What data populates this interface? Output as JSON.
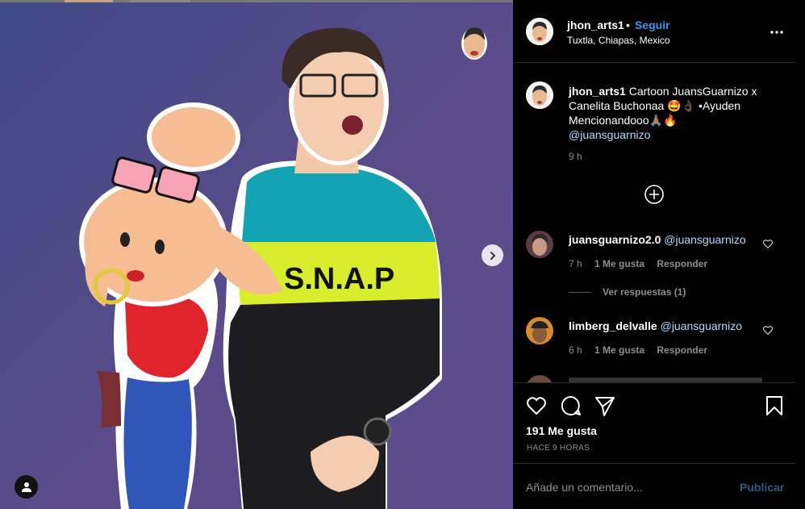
{
  "post": {
    "username": "jhon_arts1",
    "follow_label": "Seguir",
    "separator": "•",
    "location": "Tuxtla, Chiapas, Mexico",
    "caption_text": "Cartoon JuansGuarnizo x Canelita Buchonaa 🤩👌🏿 •Ayuden Mencionandooo🙏🏽🔥",
    "caption_mention": "@juansguarnizo",
    "caption_time": "9 h",
    "likes": "191 Me gusta",
    "time_ago": "HACE 9 HORAS"
  },
  "image": {
    "shirt_text": "S.N.A.P",
    "bg_colors": [
      "#3f4a86",
      "#5f4c8f"
    ]
  },
  "comments": [
    {
      "username": "juansguarnizo2.0",
      "mention": "@juansguarnizo",
      "time": "7 h",
      "likes": "1 Me gusta",
      "reply": "Responder",
      "view_replies": "Ver respuestas (1)"
    },
    {
      "username": "limberg_delvalle",
      "mention": "@juansguarnizo",
      "time": "6 h",
      "likes": "1 Me gusta",
      "reply": "Responder"
    }
  ],
  "add_comment": {
    "placeholder": "Añade un comentario...",
    "publish_label": "Publicar"
  },
  "colors": {
    "accent": "#3897f0",
    "mention": "#b3dbff",
    "muted": "#8e8e8e",
    "publish_disabled": "#2b5b85"
  },
  "icons": [
    "more-options-icon",
    "add-circle-icon",
    "heart-icon",
    "comment-icon",
    "share-icon",
    "bookmark-icon",
    "chevron-right-icon",
    "user-tag-icon"
  ]
}
